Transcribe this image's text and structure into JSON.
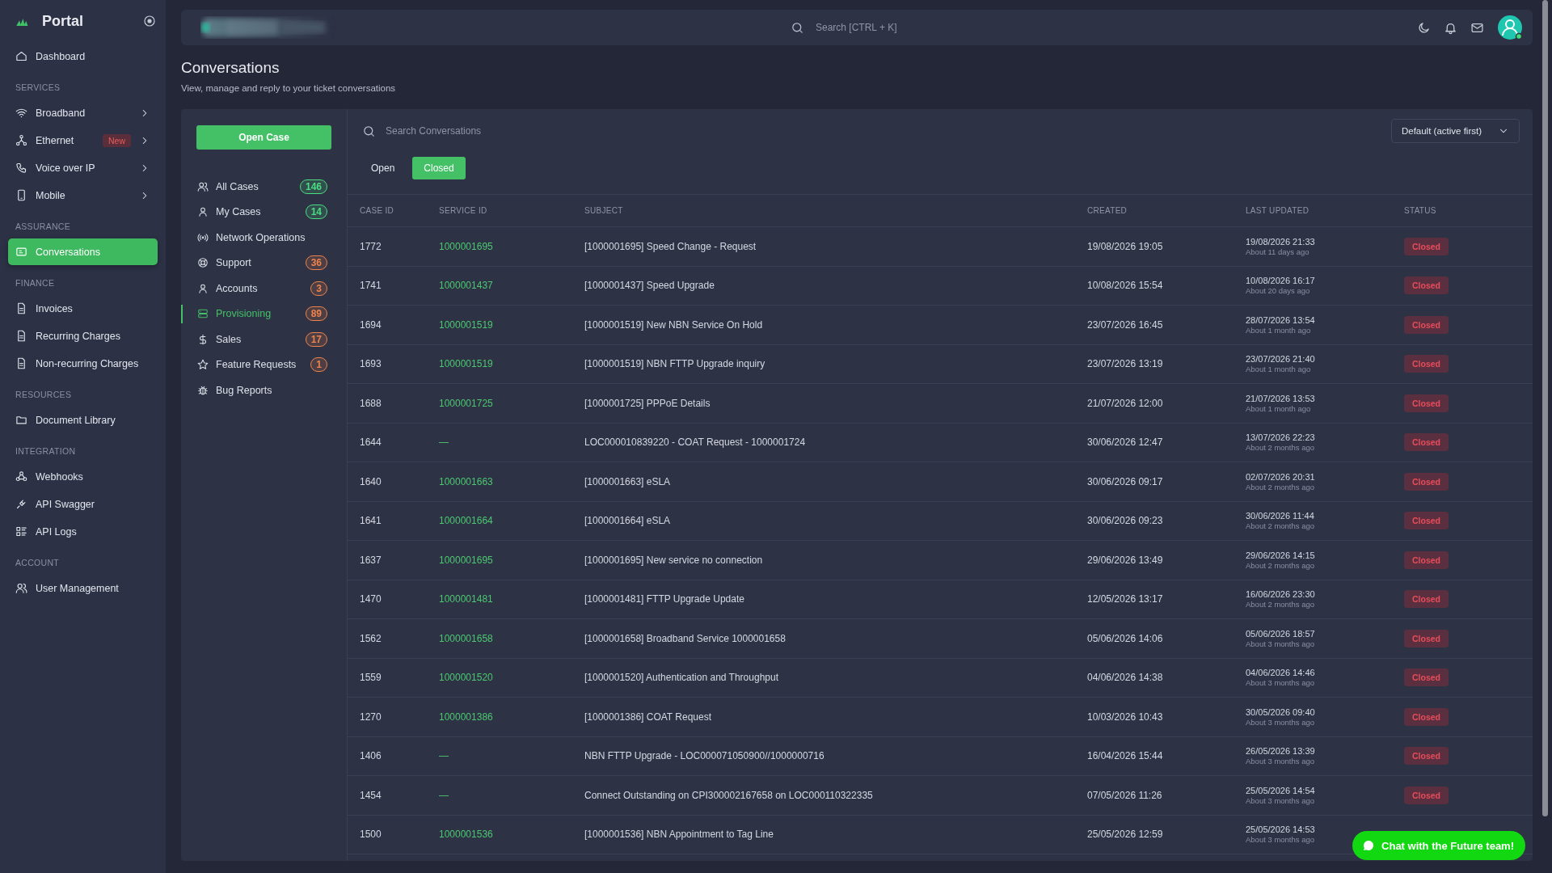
{
  "sidebar": {
    "title": "Portal",
    "items": [
      {
        "kind": "item",
        "label": "Dashboard",
        "selected": false,
        "chevron": false
      },
      {
        "kind": "section",
        "label": "SERVICES"
      },
      {
        "kind": "item",
        "label": "Broadband",
        "selected": false,
        "chevron": true
      },
      {
        "kind": "item",
        "label": "Ethernet",
        "selected": false,
        "chevron": true,
        "badge": "New"
      },
      {
        "kind": "item",
        "label": "Voice over IP",
        "selected": false,
        "chevron": true
      },
      {
        "kind": "item",
        "label": "Mobile",
        "selected": false,
        "chevron": true
      },
      {
        "kind": "section",
        "label": "ASSURANCE"
      },
      {
        "kind": "item",
        "label": "Conversations",
        "selected": true,
        "chevron": false
      },
      {
        "kind": "section",
        "label": "FINANCE"
      },
      {
        "kind": "item",
        "label": "Invoices",
        "selected": false,
        "chevron": false
      },
      {
        "kind": "item",
        "label": "Recurring Charges",
        "selected": false,
        "chevron": false
      },
      {
        "kind": "item",
        "label": "Non-recurring Charges",
        "selected": false,
        "chevron": false
      },
      {
        "kind": "section",
        "label": "RESOURCES"
      },
      {
        "kind": "item",
        "label": "Document Library",
        "selected": false,
        "chevron": false
      },
      {
        "kind": "section",
        "label": "INTEGRATION"
      },
      {
        "kind": "item",
        "label": "Webhooks",
        "selected": false,
        "chevron": false
      },
      {
        "kind": "item",
        "label": "API Swagger",
        "selected": false,
        "chevron": false
      },
      {
        "kind": "item",
        "label": "API Logs",
        "selected": false,
        "chevron": false
      },
      {
        "kind": "section",
        "label": "ACCOUNT"
      },
      {
        "kind": "item",
        "label": "User Management",
        "selected": false,
        "chevron": false
      }
    ]
  },
  "topbar": {
    "search": {
      "placeholder": "Search [CTRL + K]"
    }
  },
  "page": {
    "title": "Conversations",
    "subtitle": "View, manage and reply to your ticket conversations"
  },
  "open_case_button": "Open Case",
  "case_menu": [
    {
      "label": "All Cases",
      "count": "146",
      "color": "#4ade80",
      "selected": false
    },
    {
      "label": "My Cases",
      "count": "14",
      "color": "#4ade80",
      "selected": false
    },
    {
      "label": "Network Operations",
      "selected": false
    },
    {
      "label": "Support",
      "count": "36",
      "color": "#f0834d",
      "selected": false
    },
    {
      "label": "Accounts",
      "count": "3",
      "color": "#f0834d",
      "selected": false
    },
    {
      "label": "Provisioning",
      "count": "89",
      "color": "#f0834d",
      "selected": true
    },
    {
      "label": "Sales",
      "count": "17",
      "color": "#f0834d",
      "selected": false
    },
    {
      "label": "Feature Requests",
      "count": "1",
      "color": "#f0834d",
      "selected": false
    },
    {
      "label": "Bug Reports",
      "selected": false
    }
  ],
  "conversation_search": {
    "placeholder": "Search Conversations"
  },
  "sort_select": {
    "value": "Default (active first)"
  },
  "filter_tabs": [
    {
      "label": "Open",
      "selected": false
    },
    {
      "label": "Closed",
      "selected": true
    }
  ],
  "table": {
    "columns": [
      "CASE ID",
      "SERVICE ID",
      "SUBJECT",
      "CREATED",
      "LAST UPDATED",
      "STATUS"
    ],
    "rows": [
      {
        "case_id": "1772",
        "service_id": "1000001695",
        "subject": "[1000001695] Speed Change - Request",
        "created": "19/08/2026 19:05",
        "last_updated": "19/08/2026 21:33",
        "ago": "About 11 days ago",
        "status": "Closed"
      },
      {
        "case_id": "1741",
        "service_id": "1000001437",
        "subject": "[1000001437] Speed Upgrade",
        "created": "10/08/2026 15:54",
        "last_updated": "10/08/2026 16:17",
        "ago": "About 20 days ago",
        "status": "Closed"
      },
      {
        "case_id": "1694",
        "service_id": "1000001519",
        "subject": "[1000001519] New NBN Service On Hold",
        "created": "23/07/2026 16:45",
        "last_updated": "28/07/2026 13:54",
        "ago": "About 1 month ago",
        "status": "Closed"
      },
      {
        "case_id": "1693",
        "service_id": "1000001519",
        "subject": "[1000001519] NBN FTTP Upgrade inquiry",
        "created": "23/07/2026 13:19",
        "last_updated": "23/07/2026 21:40",
        "ago": "About 1 month ago",
        "status": "Closed"
      },
      {
        "case_id": "1688",
        "service_id": "1000001725",
        "subject": "[1000001725] PPPoE Details",
        "created": "21/07/2026 12:00",
        "last_updated": "21/07/2026 13:53",
        "ago": "About 1 month ago",
        "status": "Closed"
      },
      {
        "case_id": "1644",
        "service_id": "—",
        "subject": "LOC000010839220 - COAT Request - 1000001724",
        "created": "30/06/2026 12:47",
        "last_updated": "13/07/2026 22:23",
        "ago": "About 2 months ago",
        "status": "Closed"
      },
      {
        "case_id": "1640",
        "service_id": "1000001663",
        "subject": "[1000001663] eSLA",
        "created": "30/06/2026 09:17",
        "last_updated": "02/07/2026 20:31",
        "ago": "About 2 months ago",
        "status": "Closed"
      },
      {
        "case_id": "1641",
        "service_id": "1000001664",
        "subject": "[1000001664] eSLA",
        "created": "30/06/2026 09:23",
        "last_updated": "30/06/2026 11:44",
        "ago": "About 2 months ago",
        "status": "Closed"
      },
      {
        "case_id": "1637",
        "service_id": "1000001695",
        "subject": "[1000001695] New service no connection",
        "created": "29/06/2026 13:49",
        "last_updated": "29/06/2026 14:15",
        "ago": "About 2 months ago",
        "status": "Closed"
      },
      {
        "case_id": "1470",
        "service_id": "1000001481",
        "subject": "[1000001481] FTTP Upgrade Update",
        "created": "12/05/2026 13:17",
        "last_updated": "16/06/2026 23:30",
        "ago": "About 2 months ago",
        "status": "Closed"
      },
      {
        "case_id": "1562",
        "service_id": "1000001658",
        "subject": "[1000001658] Broadband Service 1000001658",
        "created": "05/06/2026 14:06",
        "last_updated": "05/06/2026 18:57",
        "ago": "About 3 months ago",
        "status": "Closed"
      },
      {
        "case_id": "1559",
        "service_id": "1000001520",
        "subject": "[1000001520] Authentication and Throughput",
        "created": "04/06/2026 14:38",
        "last_updated": "04/06/2026 14:46",
        "ago": "About 3 months ago",
        "status": "Closed"
      },
      {
        "case_id": "1270",
        "service_id": "1000001386",
        "subject": "[1000001386] COAT Request",
        "created": "10/03/2026 10:43",
        "last_updated": "30/05/2026 09:40",
        "ago": "About 3 months ago",
        "status": "Closed"
      },
      {
        "case_id": "1406",
        "service_id": "—",
        "subject": "NBN FTTP Upgrade - LOC000071050900//1000000716",
        "created": "16/04/2026 15:44",
        "last_updated": "26/05/2026 13:39",
        "ago": "About 3 months ago",
        "status": "Closed"
      },
      {
        "case_id": "1454",
        "service_id": "—",
        "subject": "Connect Outstanding on CPI300002167658 on LOC000110322335",
        "created": "07/05/2026 11:26",
        "last_updated": "25/05/2026 14:54",
        "ago": "About 3 months ago",
        "status": "Closed"
      },
      {
        "case_id": "1500",
        "service_id": "1000001536",
        "subject": "[1000001536] NBN Appointment to Tag Line",
        "created": "25/05/2026 12:59",
        "last_updated": "25/05/2026 14:53",
        "ago": "About 3 months ago"
      }
    ]
  },
  "chat_button": "Chat with the Future team!"
}
